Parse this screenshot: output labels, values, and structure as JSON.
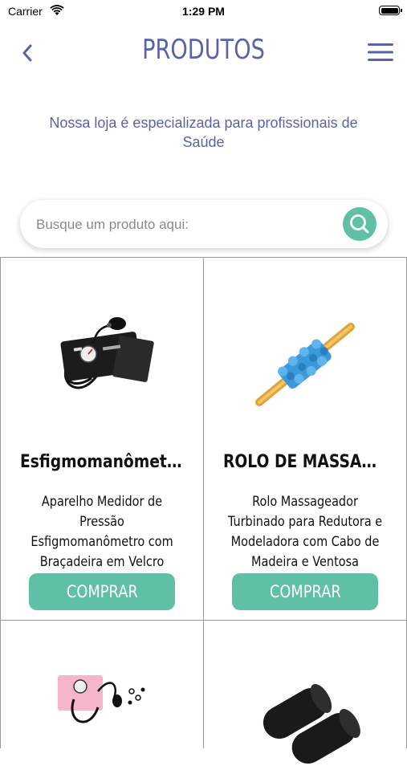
{
  "status_bar": {
    "carrier": "Carrier",
    "time": "1:29 PM"
  },
  "header": {
    "title": "PRODUTOS",
    "back_icon": "chevron-left-icon",
    "menu_icon": "hamburger-menu-icon"
  },
  "subtitle": "Nossa loja é especializada para profissionais de Saúde",
  "search": {
    "placeholder": "Busque um produto aqui:",
    "icon": "search-icon"
  },
  "colors": {
    "accent": "#5b62a8",
    "button": "#5fc0a5"
  },
  "products": [
    {
      "name": "Esfigmomanômetro",
      "description": "Aparelho Medidor de Pressão Esfigmomanômetro com Braçadeira em Velcro Premiu...",
      "button": "COMPRAR",
      "image": "sphygmomanometer"
    },
    {
      "name": "ROLO DE MASSAGEM...",
      "description": "Rolo Massageador Turbinado para Redutora e Modeladora com Cabo de Madeira e Ventosa",
      "button": "COMPRAR",
      "image": "massage-roller"
    },
    {
      "image": "blood-pressure-kit"
    },
    {
      "image": "foam-rollers"
    }
  ]
}
